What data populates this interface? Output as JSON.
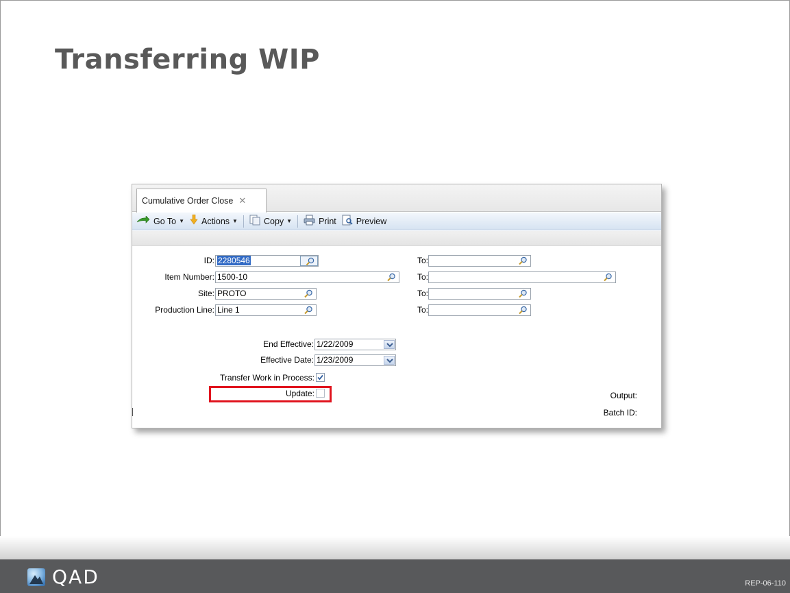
{
  "slide": {
    "title": "Transferring WIP",
    "code": "REP-06-110"
  },
  "logo": {
    "text": "QAD"
  },
  "tab": {
    "label": "Cumulative Order Close",
    "close_glyph": "✕"
  },
  "toolbar": {
    "goto_label": "Go To",
    "actions_label": "Actions",
    "copy_label": "Copy",
    "print_label": "Print",
    "preview_label": "Preview"
  },
  "form": {
    "id": {
      "label": "ID:",
      "value": "2280546",
      "to_label": "To:",
      "to_value": ""
    },
    "item_number": {
      "label": "Item Number:",
      "value": "1500-10",
      "to_label": "To:",
      "to_value": ""
    },
    "site": {
      "label": "Site:",
      "value": "PROTO",
      "to_label": "To:",
      "to_value": ""
    },
    "production_line": {
      "label": "Production Line:",
      "value": "Line 1",
      "to_label": "To:",
      "to_value": ""
    },
    "end_effective": {
      "label": "End Effective:",
      "value": "1/22/2009"
    },
    "effective_date": {
      "label": "Effective Date:",
      "value": "1/23/2009"
    },
    "transfer_wip": {
      "label": "Transfer Work in Process:",
      "checked": true
    },
    "update": {
      "label": "Update:",
      "checked": false
    },
    "output": {
      "label": "Output:"
    },
    "batch_id": {
      "label": "Batch ID:"
    }
  },
  "colors": {
    "title": "#595959",
    "footer": "#58595b",
    "highlight": "#e0141e",
    "toolbar_top": "#f3f7fc",
    "toolbar_bottom": "#d6e3f2",
    "selection": "#316ac5"
  },
  "icons": [
    "goto-arrow-icon",
    "actions-flag-icon",
    "copy-icon",
    "print-icon",
    "preview-icon",
    "lookup-magnifier-icon",
    "dropdown-chevron-icon",
    "checkbox-check-icon",
    "qad-logo-icon",
    "tab-close-icon"
  ]
}
